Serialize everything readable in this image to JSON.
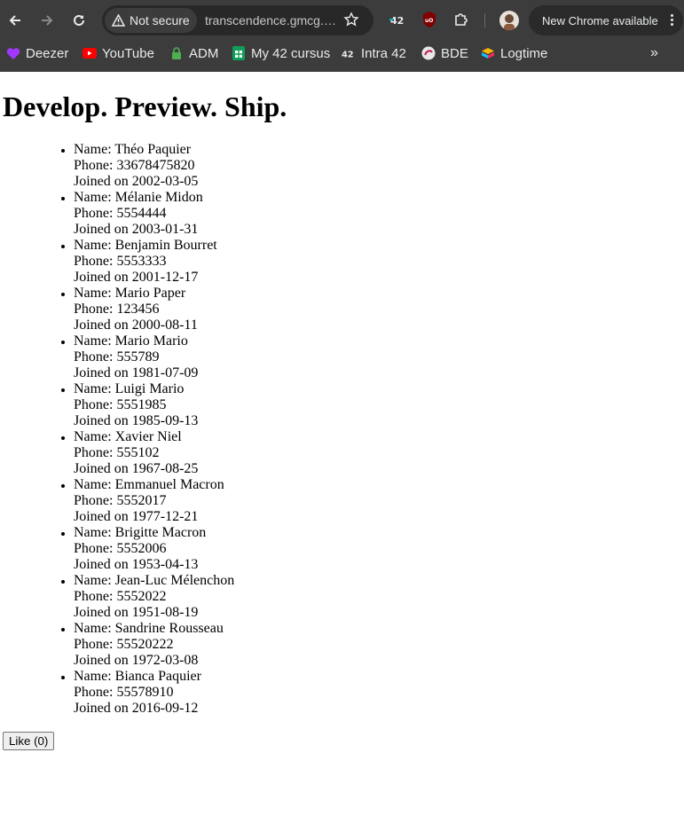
{
  "browser": {
    "security_label": "Not secure",
    "url": "transcendence.gmcg.…",
    "update_label": "New Chrome available",
    "bookmarks": [
      {
        "label": "Deezer",
        "icon": "deezer-heart-icon"
      },
      {
        "label": "YouTube",
        "icon": "youtube-icon"
      },
      {
        "label": "ADM",
        "icon": "lock-icon"
      },
      {
        "label": "My 42 cursus",
        "icon": "sheets-icon"
      },
      {
        "label": "Intra 42",
        "icon": "42-logo-icon"
      },
      {
        "label": "BDE",
        "icon": "bde-icon"
      },
      {
        "label": "Logtime",
        "icon": "logtime-icon"
      }
    ]
  },
  "page": {
    "title": "Develop. Preview. Ship.",
    "members": [
      {
        "name": "Name: Théo Paquier",
        "phone": "Phone: 33678475820",
        "joined": "Joined on 2002-03-05"
      },
      {
        "name": "Name: Mélanie Midon",
        "phone": "Phone: 5554444",
        "joined": "Joined on 2003-01-31"
      },
      {
        "name": "Name: Benjamin Bourret",
        "phone": "Phone: 5553333",
        "joined": "Joined on 2001-12-17"
      },
      {
        "name": "Name: Mario Paper",
        "phone": "Phone: 123456",
        "joined": "Joined on 2000-08-11"
      },
      {
        "name": "Name: Mario Mario",
        "phone": "Phone: 555789",
        "joined": "Joined on 1981-07-09"
      },
      {
        "name": "Name: Luigi Mario",
        "phone": "Phone: 5551985",
        "joined": "Joined on 1985-09-13"
      },
      {
        "name": "Name: Xavier Niel",
        "phone": "Phone: 555102",
        "joined": "Joined on 1967-08-25"
      },
      {
        "name": "Name: Emmanuel Macron",
        "phone": "Phone: 5552017",
        "joined": "Joined on 1977-12-21"
      },
      {
        "name": "Name: Brigitte Macron",
        "phone": "Phone: 5552006",
        "joined": "Joined on 1953-04-13"
      },
      {
        "name": "Name: Jean-Luc Mélenchon",
        "phone": "Phone: 5552022",
        "joined": "Joined on 1951-08-19"
      },
      {
        "name": "Name: Sandrine Rousseau",
        "phone": "Phone: 55520222",
        "joined": "Joined on 1972-03-08"
      },
      {
        "name": "Name: Bianca Paquier",
        "phone": "Phone: 55578910",
        "joined": "Joined on 2016-09-12"
      }
    ],
    "like_label": "Like (0)"
  }
}
